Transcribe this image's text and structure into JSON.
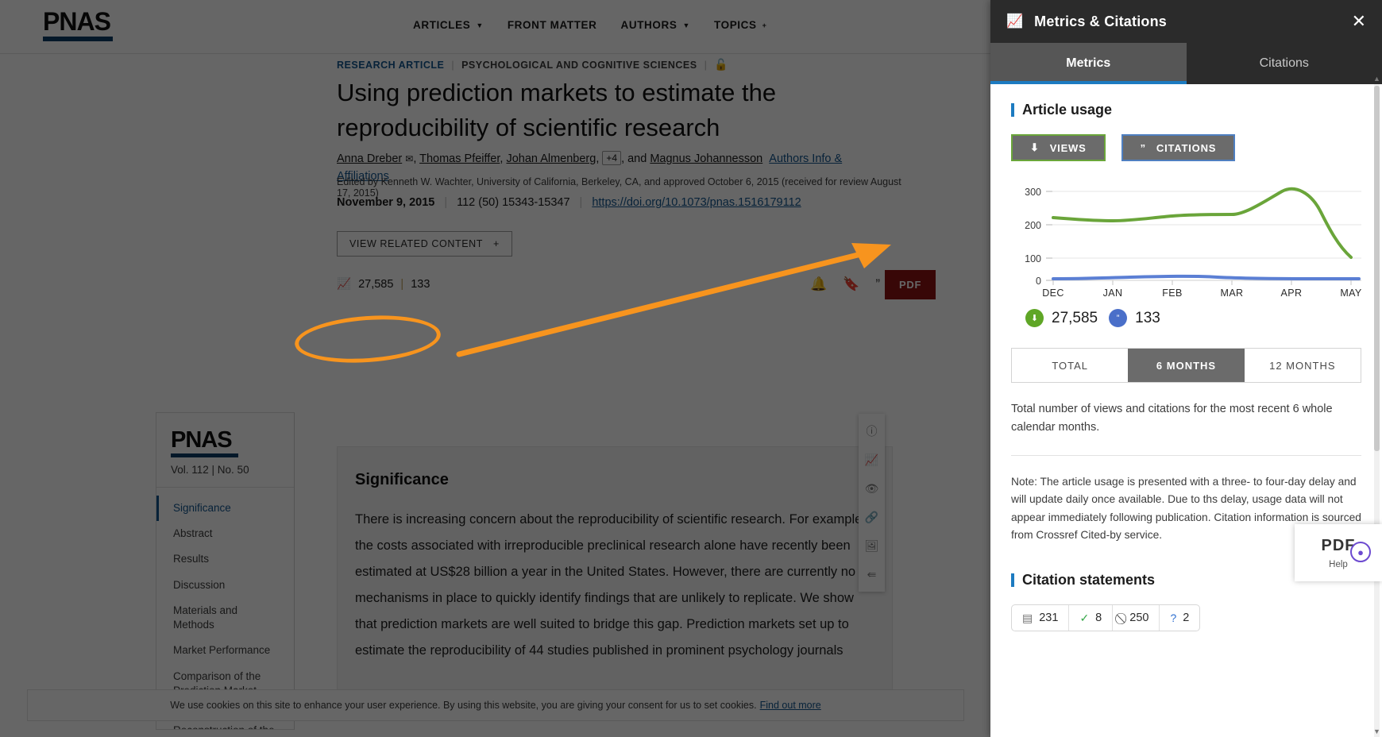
{
  "site": {
    "logo": "PNAS",
    "nav": [
      {
        "label": "ARTICLES",
        "caret": "chevron-down-icon"
      },
      {
        "label": "FRONT MATTER",
        "caret": ""
      },
      {
        "label": "AUTHORS",
        "caret": "chevron-down-icon"
      },
      {
        "label": "TOPICS",
        "caret": "plus-icon"
      }
    ]
  },
  "article": {
    "type": "RESEARCH ARTICLE",
    "subject": "PSYCHOLOGICAL AND COGNITIVE SCIENCES",
    "access_icon": "open-lock-icon",
    "title": "Using prediction markets to estimate the reproducibility of scientific research",
    "authors": {
      "a1": "Anna Dreber",
      "mail_icon": "envelope-icon",
      "a2": "Thomas Pfeiffer",
      "a3": "Johan Almenberg",
      "more": "+4",
      "and": ", and ",
      "a4": "Magnus Johannesson",
      "affiliations_link": "Authors Info & Affiliations"
    },
    "edited": "Edited by Kenneth W. Wachter, University of California, Berkeley, CA, and approved October 6, 2015 (received for review August 17, 2015)",
    "date": "November 9, 2015",
    "citation": "112 (50) 15343-15347",
    "doi": "https://doi.org/10.1073/pnas.1516179112",
    "related_button": "VIEW RELATED CONTENT",
    "related_plus": "+",
    "metric_pill": {
      "icon": "trending-up-icon",
      "views": "27,585",
      "sep": "|",
      "citations": "133"
    },
    "pdf_button": "PDF"
  },
  "toc": {
    "logo": "PNAS",
    "volume": "Vol. 112 | No. 50",
    "items": [
      {
        "label": "Significance",
        "active": true
      },
      {
        "label": "Abstract",
        "active": false
      },
      {
        "label": "Results",
        "active": false
      },
      {
        "label": "Discussion",
        "active": false
      },
      {
        "label": "Materials and Methods",
        "active": false
      },
      {
        "label": "Market Performance",
        "active": false
      },
      {
        "label": "Comparison of the Prediction Market and...",
        "active": false
      },
      {
        "label": "Reconstruction of the",
        "active": false
      }
    ]
  },
  "significance": {
    "heading": "Significance",
    "body": "There is increasing concern about the reproducibility of scientific research. For example, the costs associated with irreproducible preclinical research alone have recently been estimated at US$28 billion a year in the United States. However, there are currently no mechanisms in place to quickly identify findings that are unlikely to replicate. We show that prediction markets are well suited to bridge this gap. Prediction markets set up to estimate the reproducibility of 44 studies published in prominent psychology journals"
  },
  "vtoolbar": [
    {
      "icon": "info-icon",
      "selected": false
    },
    {
      "icon": "trending-up-icon",
      "selected": true
    },
    {
      "icon": "eye-icon",
      "selected": false
    },
    {
      "icon": "link-icon",
      "selected": false
    },
    {
      "icon": "image-icon",
      "selected": false
    },
    {
      "icon": "share-icon",
      "selected": false
    }
  ],
  "cookie": {
    "text": "We use cookies on this site to enhance your user experience. By using this website, you are giving your consent for us to set cookies.",
    "link": "Find out more"
  },
  "panel": {
    "icon": "trending-up-icon",
    "title": "Metrics & Citations",
    "close_icon": "close-icon",
    "tabs": [
      {
        "label": "Metrics",
        "active": true
      },
      {
        "label": "Citations",
        "active": false
      }
    ],
    "article_usage_heading": "Article usage",
    "toggle_views": {
      "label": "VIEWS",
      "icon": "download-icon"
    },
    "toggle_citations": {
      "label": "CITATIONS",
      "icon": "quote-icon"
    },
    "totals": {
      "views_icon": "download-circle-icon",
      "views": "27,585",
      "citations_icon": "quote-circle-icon",
      "citations": "133"
    },
    "range_tabs": [
      {
        "label": "TOTAL",
        "active": false
      },
      {
        "label": "6 MONTHS",
        "active": true
      },
      {
        "label": "12 MONTHS",
        "active": false
      }
    ],
    "range_desc": "Total number of views and citations for the most recent 6 whole calendar months.",
    "note": "Note: The article usage is presented with a three- to four-day delay and will update daily once available. Due to ths delay, usage data will not appear immediately following publication. Citation information is sourced from Crossref Cited-by service.",
    "citation_statements_heading": "Citation statements",
    "badges": [
      {
        "icon": "document-icon",
        "color": "gray",
        "glyph": "▤",
        "value": "231"
      },
      {
        "icon": "check-circle-icon",
        "color": "green",
        "glyph": "✓",
        "value": "8"
      },
      {
        "icon": "slash-circle-icon",
        "color": "dark",
        "glyph": "⁄",
        "value": "250"
      },
      {
        "icon": "question-circle-icon",
        "color": "blue",
        "glyph": "?",
        "value": "2"
      }
    ]
  },
  "help": {
    "pdf": "PDF",
    "label": "Help",
    "bubble_icon": "chat-icon"
  },
  "chart_data": {
    "type": "line",
    "title": "Article usage",
    "xlabel": "",
    "ylabel": "",
    "x": [
      "DEC",
      "JAN",
      "FEB",
      "MAR",
      "APR",
      "MAY"
    ],
    "ylim": [
      0,
      340
    ],
    "yticks": [
      0,
      100,
      200,
      300
    ],
    "grid": true,
    "legend": [
      "VIEWS",
      "CITATIONS"
    ],
    "series": [
      {
        "name": "VIEWS",
        "color": "#6aa53a",
        "values": [
          188,
          182,
          190,
          196,
          315,
          135
        ]
      },
      {
        "name": "CITATIONS",
        "color": "#4a6fc9",
        "values": [
          4,
          4,
          5,
          3,
          3,
          3
        ]
      }
    ]
  }
}
